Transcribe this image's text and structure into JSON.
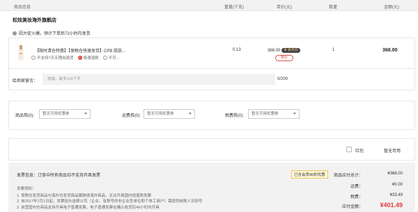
{
  "header": {
    "product_info": "商品信息",
    "weight": "重量(千克)",
    "unit_price": "单价(元)",
    "quantity": "数量",
    "amount": "金额(元)"
  },
  "shop": {
    "name": "松炫美妆海外旗舰店"
  },
  "notice": {
    "text": "因大促火爆，预计下单后72小时内发货"
  },
  "product": {
    "name": "【限时清仓特惠】【保税仓快速发货】CPB 肌肤...",
    "tags": [
      "不支持7天无理由退货",
      "极速退款",
      "不可..."
    ],
    "weight": "0.13",
    "price": "368.00",
    "vip_label": "会员价",
    "promo_label": "特价",
    "quantity": "1",
    "amount": "368.00"
  },
  "message": {
    "label": "给商家留言：",
    "placeholder": "选填，最多100个字",
    "count": "0/200"
  },
  "coupons": {
    "goods_label": "商品券(0):",
    "goods_value": "暂无可用优惠券",
    "shipping_label": "运费券(0):",
    "shipping_value": "暂无可用优惠券",
    "tax_label": "税费券(0):",
    "tax_value": "暂无可用优惠券"
  },
  "redpack": {
    "label": "红包",
    "value": "暂无可用"
  },
  "invoice": {
    "info": "发票信息：订单中所有商品均不支持开具发票",
    "notes_title": "发票须知：",
    "notes": [
      "1. 保税仓发货商品与海外仓发货商品属跨境海外商品，无法开具国内增值税发票",
      "2. 自2017年7月1日起，发票抬头选择公司（企业、有税号的非企业性单位和个体工商户）需提供纳税人识别号",
      "3. 自营国内仓商品支持开具电子普通发票，电子普通发票在确认收货后48小时内开具"
    ]
  },
  "summary": {
    "save_badge": "已含会员96折优惠",
    "goods_total_label": "商品应付总计：",
    "goods_total": "¥368.00",
    "shipping_label": "运费：",
    "shipping": "¥0.00",
    "tax_label": "税费：",
    "tax": "¥33.49",
    "grand_label": "应付金额：",
    "grand_total": "¥401.49"
  }
}
